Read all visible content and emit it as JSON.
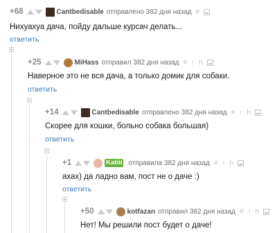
{
  "comments": [
    {
      "rating": "+68",
      "author": "Cantbedisable",
      "meta": "отправлено 382 дня назад",
      "body": "Нихуахуа дача, пойду дальше курсач делать...",
      "reply": "ответить"
    },
    {
      "rating": "+25",
      "author": "MiHass",
      "meta": "отправил 382 дня назад",
      "body": "Наверное это не вся дача, а только домик для собаки.",
      "reply": "ответить"
    },
    {
      "rating": "+14",
      "author": "Cantbedisable",
      "meta": "отправлено 382 дня назад",
      "body": "Скорее для кошки, больно собака большая)",
      "reply": "ответить"
    },
    {
      "rating": "+1",
      "author": "Katiii",
      "meta": "отправила 382 дня назад",
      "body": "ахах) да ладно вам, пост не о даче :)",
      "reply": "ответить"
    },
    {
      "rating": "+50",
      "author": "kotfazan",
      "meta": "отправил 382 дня назад",
      "body": "Нет! Мы решили пост будет о даче!",
      "reply": ""
    }
  ],
  "tools": {
    "hash": "#",
    "up_arrow": "↑",
    "branch": "h"
  },
  "colors": {
    "reply_link": "#3a77b8",
    "katiii_tag": "#6ab33a"
  },
  "icons": [
    "arrow-up-icon",
    "arrow-down-icon",
    "avatar-icon",
    "hash-icon",
    "parent-arrow-icon",
    "branch-icon",
    "save-icon",
    "collapse-icon"
  ]
}
